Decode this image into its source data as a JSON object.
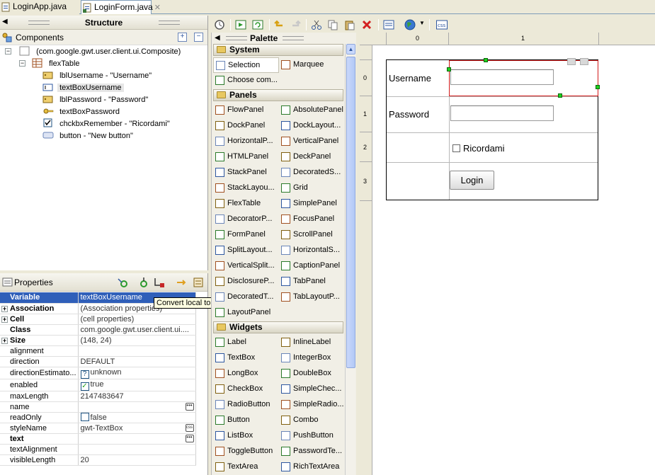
{
  "tabs": [
    {
      "label": "LoginApp.java",
      "active": false
    },
    {
      "label": "LoginForm.java",
      "active": true
    }
  ],
  "structure": {
    "title": "Structure",
    "components_label": "Components",
    "tree": [
      {
        "label": "(com.google.gwt.user.client.ui.Composite)",
        "icon": "composite-icon"
      },
      {
        "label": "flexTable",
        "icon": "flextable-icon"
      },
      {
        "label": "lblUsername - \"Username\"",
        "icon": "label-icon"
      },
      {
        "label": "textBoxUsername",
        "icon": "textbox-icon",
        "selected": true
      },
      {
        "label": "lblPassword - \"Password\"",
        "icon": "label-icon"
      },
      {
        "label": "textBoxPassword",
        "icon": "password-icon"
      },
      {
        "label": "chckbxRemember - \"Ricordami\"",
        "icon": "checkbox-icon"
      },
      {
        "label": "button - \"New button\"",
        "icon": "button-icon"
      }
    ]
  },
  "properties": {
    "title": "Properties",
    "tooltip": "Convert local to field",
    "rows": [
      {
        "name": "Variable",
        "value": "textBoxUsername",
        "bold": true,
        "selected": true
      },
      {
        "name": "Association",
        "value": "(Association properties)",
        "bold": true,
        "expandable": true
      },
      {
        "name": "Cell",
        "value": "(cell properties)",
        "bold": true,
        "expandable": true
      },
      {
        "name": "Class",
        "value": "com.google.gwt.user.client.ui....",
        "bold": true
      },
      {
        "name": "Size",
        "value": "(148, 24)",
        "bold": true,
        "expandable": true
      },
      {
        "name": "alignment",
        "value": ""
      },
      {
        "name": "direction",
        "value": "DEFAULT"
      },
      {
        "name": "directionEstimato...",
        "value": "unknown"
      },
      {
        "name": "enabled",
        "value": "true",
        "checkbox": true,
        "checked": true
      },
      {
        "name": "maxLength",
        "value": "2147483647"
      },
      {
        "name": "name",
        "value": "",
        "dots": true
      },
      {
        "name": "readOnly",
        "value": "false",
        "checkbox": true,
        "checked": false
      },
      {
        "name": "styleName",
        "value": "gwt-TextBox",
        "css": true
      },
      {
        "name": "text",
        "value": "",
        "bold": true,
        "dots": true
      },
      {
        "name": "textAlignment",
        "value": ""
      },
      {
        "name": "visibleLength",
        "value": "20"
      }
    ]
  },
  "palette": {
    "title": "Palette",
    "categories": [
      {
        "label": "System",
        "items": [
          {
            "label": "Selection",
            "selected": true
          },
          {
            "label": "Marquee"
          },
          {
            "label": "Choose com..."
          }
        ]
      },
      {
        "label": "Panels",
        "items": [
          {
            "label": "FlowPanel"
          },
          {
            "label": "AbsolutePanel"
          },
          {
            "label": "DockPanel"
          },
          {
            "label": "DockLayout..."
          },
          {
            "label": "HorizontalP..."
          },
          {
            "label": "VerticalPanel"
          },
          {
            "label": "HTMLPanel"
          },
          {
            "label": "DeckPanel"
          },
          {
            "label": "StackPanel"
          },
          {
            "label": "DecoratedS..."
          },
          {
            "label": "StackLayou..."
          },
          {
            "label": "Grid"
          },
          {
            "label": "FlexTable"
          },
          {
            "label": "SimplePanel"
          },
          {
            "label": "DecoratorP..."
          },
          {
            "label": "FocusPanel"
          },
          {
            "label": "FormPanel"
          },
          {
            "label": "ScrollPanel"
          },
          {
            "label": "SplitLayout..."
          },
          {
            "label": "HorizontalS..."
          },
          {
            "label": "VerticalSplit..."
          },
          {
            "label": "CaptionPanel"
          },
          {
            "label": "DisclosureP..."
          },
          {
            "label": "TabPanel"
          },
          {
            "label": "DecoratedT..."
          },
          {
            "label": "TabLayoutP..."
          },
          {
            "label": "LayoutPanel"
          }
        ]
      },
      {
        "label": "Widgets",
        "items": [
          {
            "label": "Label"
          },
          {
            "label": "InlineLabel"
          },
          {
            "label": "TextBox"
          },
          {
            "label": "IntegerBox"
          },
          {
            "label": "LongBox"
          },
          {
            "label": "DoubleBox"
          },
          {
            "label": "CheckBox"
          },
          {
            "label": "SimpleChec..."
          },
          {
            "label": "RadioButton"
          },
          {
            "label": "SimpleRadio..."
          },
          {
            "label": "Button"
          },
          {
            "label": "Combo"
          },
          {
            "label": "ListBox"
          },
          {
            "label": "PushButton"
          },
          {
            "label": "ToggleButton"
          },
          {
            "label": "PasswordTe..."
          },
          {
            "label": "TextArea"
          },
          {
            "label": "RichTextArea"
          }
        ]
      }
    ]
  },
  "toolbar": {
    "icons": [
      "gwt-icon",
      "run-icon",
      "refresh-icon",
      "undo-icon",
      "redo-icon",
      "cut-icon",
      "copy-icon",
      "paste-icon",
      "delete-icon",
      "properties-icon",
      "globe-icon",
      "css-icon"
    ]
  },
  "canvas": {
    "col_labels": [
      "0",
      "1"
    ],
    "row_labels": [
      "0",
      "1",
      "2",
      "3"
    ],
    "form": {
      "username_label": "Username",
      "password_label": "Password",
      "remember_label": "Ricordami",
      "login_button": "Login"
    }
  }
}
